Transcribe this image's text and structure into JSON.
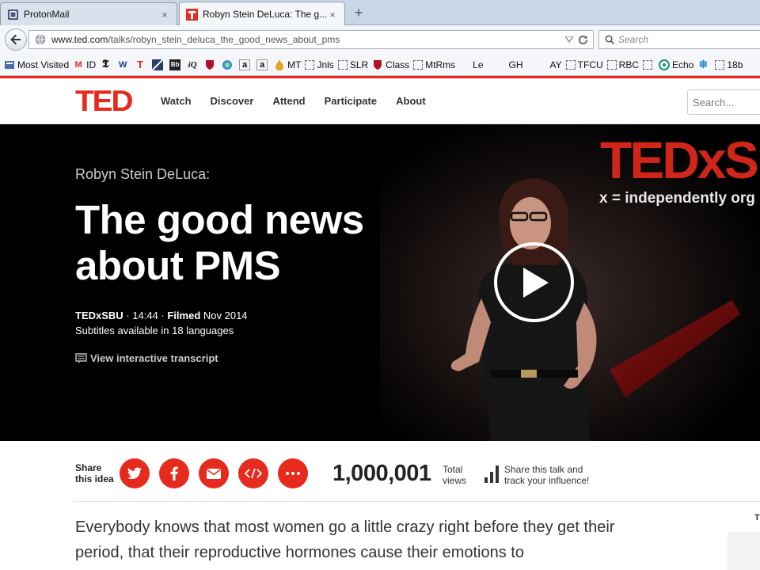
{
  "browser": {
    "tabs": [
      {
        "title": "ProtonMail",
        "close": "×"
      },
      {
        "title": "Robyn Stein DeLuca: The g...",
        "close": "×"
      }
    ],
    "new_tab": "+",
    "url_host": "www.ted.com",
    "url_path": "/talks/robyn_stein_deluca_the_good_news_about_pms",
    "search_placeholder": "Search",
    "bookmarks": [
      "Most Visited",
      "ID",
      "MT",
      "Jnls",
      "SLR",
      "Class",
      "MtRms",
      "Le",
      "GH",
      "AY",
      "TFCU",
      "RBC",
      "Echo",
      "18b"
    ]
  },
  "ted": {
    "logo": "TED",
    "nav": [
      "Watch",
      "Discover",
      "Attend",
      "Participate",
      "About"
    ],
    "search_placeholder": "Search..."
  },
  "talk": {
    "speaker": "Robyn Stein DeLuca:",
    "title": "The good news about PMS",
    "event": "TEDxSBU",
    "duration": "14:44",
    "filmed_label": "Filmed",
    "filmed_date": "Nov 2014",
    "subtitles": "Subtitles available in 18 languages",
    "transcript_link": "View interactive transcript",
    "backdrop_logo": "TEDxS",
    "backdrop_tagline": "x = independently org"
  },
  "share": {
    "label_line1": "Share",
    "label_line2": "this idea",
    "views": "1,000,001",
    "views_line1": "Total",
    "views_line2": "views",
    "influence_line1": "Share this talk and",
    "influence_line2": "track your influence!"
  },
  "description": "Everybody knows that most women go a little crazy right before they get their period, that their reproductive hormones cause their emotions to",
  "side_fragment": "T",
  "colors": {
    "ted_red": "#e62b1e",
    "hero_bg": "#000000"
  }
}
